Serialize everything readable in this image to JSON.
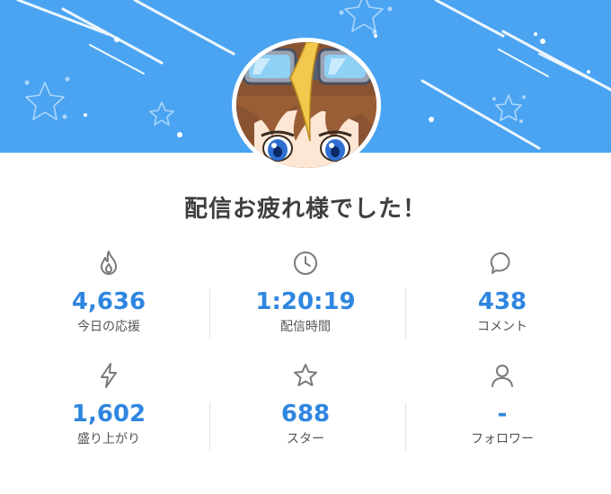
{
  "title": "配信お疲れ様でした！",
  "colors": {
    "banner": "#4aa4f2",
    "accent": "#2f86e0"
  },
  "stats": [
    {
      "icon": "flame-icon",
      "value": "4,636",
      "label": "今日の応援"
    },
    {
      "icon": "clock-icon",
      "value": "1:20:19",
      "label": "配信時間"
    },
    {
      "icon": "comment-bubble-icon",
      "value": "438",
      "label": "コメント"
    },
    {
      "icon": "lightning-icon",
      "value": "1,602",
      "label": "盛り上がり"
    },
    {
      "icon": "star-icon",
      "value": "688",
      "label": "スター"
    },
    {
      "icon": "person-icon",
      "value": "-",
      "label": "フォロワー"
    }
  ]
}
